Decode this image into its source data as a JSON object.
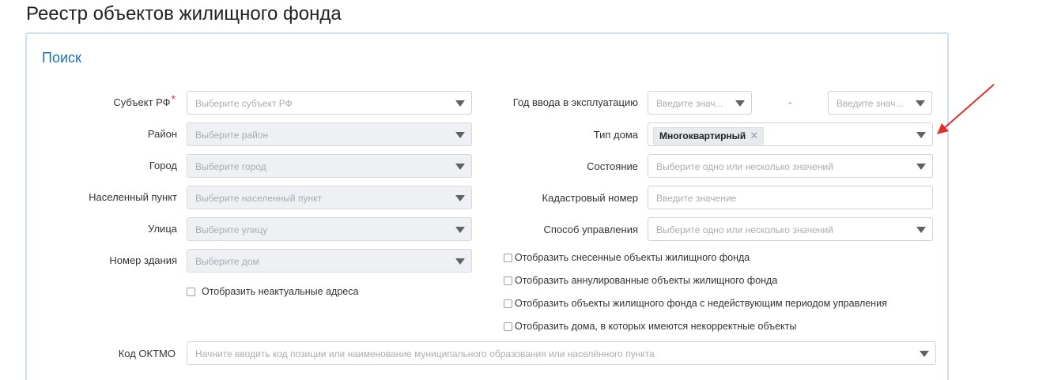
{
  "page": {
    "title": "Реестр объектов жилищного фонда"
  },
  "search": {
    "title": "Поиск",
    "subject": {
      "label": "Субъект РФ",
      "required_mark": "*",
      "placeholder": "Выберите субъект РФ"
    },
    "district": {
      "label": "Район",
      "placeholder": "Выберите район"
    },
    "city": {
      "label": "Город",
      "placeholder": "Выберите город"
    },
    "settlement": {
      "label": "Населенный пункт",
      "placeholder": "Выберите населенный пункт"
    },
    "street": {
      "label": "Улица",
      "placeholder": "Выберите улицу"
    },
    "building": {
      "label": "Номер здания",
      "placeholder": "Выберите дом"
    },
    "show_outdated": {
      "label": "Отобразить неактуальные адреса",
      "checked": false
    },
    "year": {
      "label": "Год ввода в эксплуатацию",
      "from_placeholder": "Введите знач...",
      "separator": "-",
      "to_placeholder": "Введите знач..."
    },
    "house_type": {
      "label": "Тип дома",
      "selected_tag": "Многоквартирный",
      "remove_glyph": "✕"
    },
    "state": {
      "label": "Состояние",
      "placeholder": "Выберите одно или несколько значений"
    },
    "cadastral": {
      "label": "Кадастровый номер",
      "placeholder": "Введите значение"
    },
    "management": {
      "label": "Способ управления",
      "placeholder": "Выберите одно или несколько значений"
    },
    "checkboxes": [
      {
        "label": "Отобразить снесенные объекты жилищного фонда",
        "checked": false
      },
      {
        "label": "Отобразить аннулированные объекты жилищного фонда",
        "checked": false
      },
      {
        "label": "Отобразить объекты жилищного фонда с недействующим периодом управления",
        "checked": false
      },
      {
        "label": "Отобразить дома, в которых имеются некорректные объекты",
        "checked": false
      }
    ],
    "oktmo": {
      "label": "Код ОКТМО",
      "placeholder": "Начните вводить код позиции или наименование муниципального образования или населённого пункта"
    }
  },
  "annotation": {
    "arrow_color": "#e0302a"
  },
  "colors": {
    "accent": "#1b72b6",
    "panel_border": "#cfe1f0",
    "required": "#e0312f"
  },
  "icons": [
    "caret-down-icon",
    "remove-tag-icon",
    "annotation-arrow"
  ]
}
